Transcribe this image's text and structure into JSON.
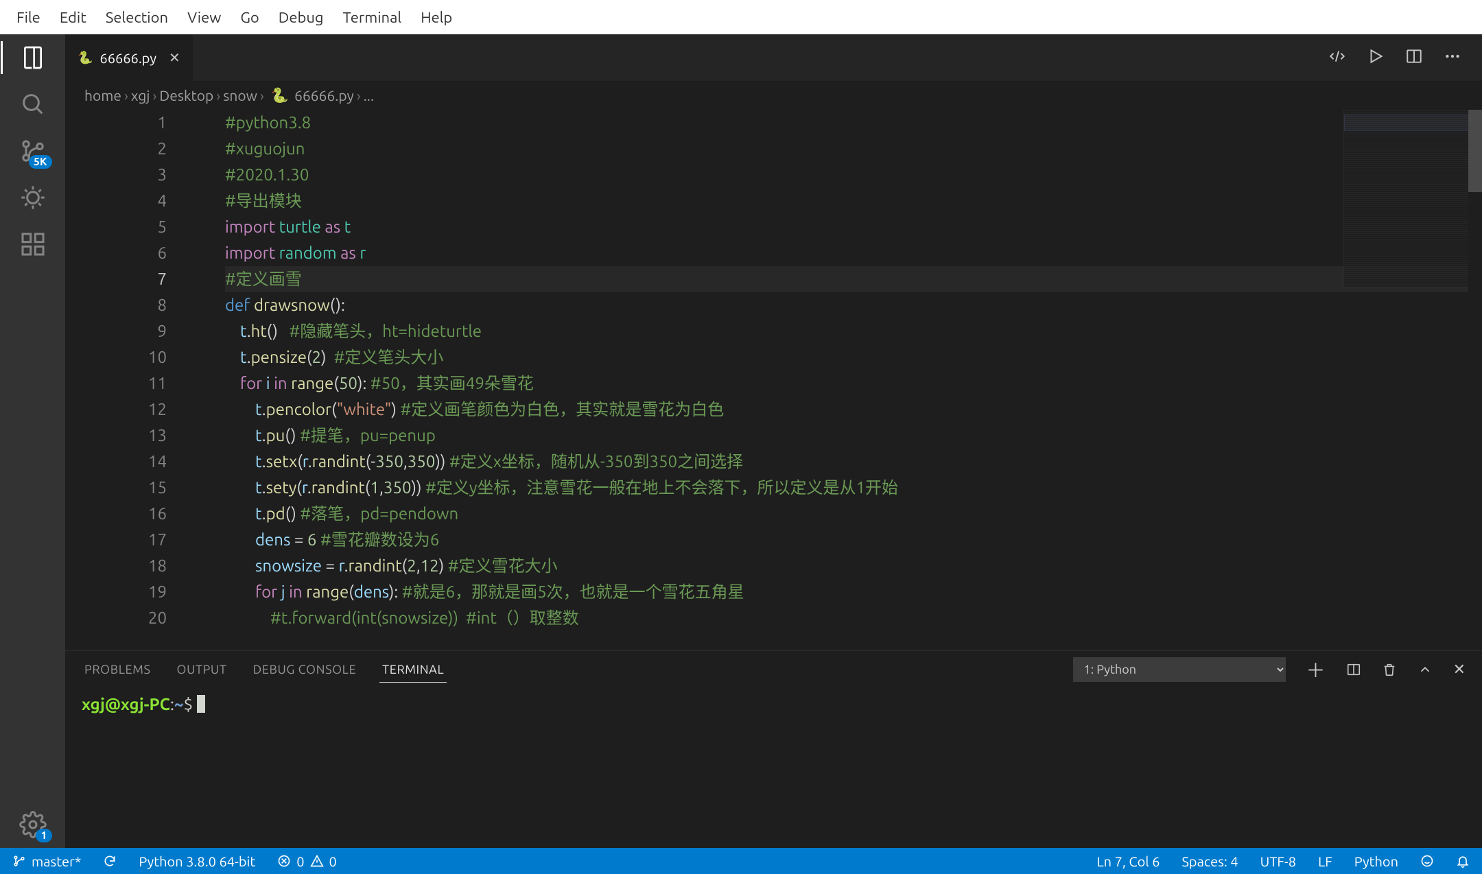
{
  "menu": [
    "File",
    "Edit",
    "Selection",
    "View",
    "Go",
    "Debug",
    "Terminal",
    "Help"
  ],
  "activity": {
    "scm_badge": "5K",
    "settings_badge": "1"
  },
  "tab": {
    "filename": "66666.py"
  },
  "breadcrumb": [
    "home",
    "xgj",
    "Desktop",
    "snow",
    "66666.py",
    "..."
  ],
  "code": {
    "lines": [
      {
        "n": "1",
        "seg": [
          [
            "c-cmt",
            "#python3.8"
          ]
        ]
      },
      {
        "n": "2",
        "seg": [
          [
            "c-cmt",
            "#xuguojun"
          ]
        ]
      },
      {
        "n": "3",
        "seg": [
          [
            "c-cmt",
            "#2020.1.30"
          ]
        ]
      },
      {
        "n": "4",
        "seg": [
          [
            "c-cmt",
            "#导出模块"
          ]
        ]
      },
      {
        "n": "5",
        "seg": [
          [
            "c-kw",
            "import"
          ],
          [
            "c-pn",
            " "
          ],
          [
            "c-mod",
            "turtle"
          ],
          [
            "c-pn",
            " "
          ],
          [
            "c-kw",
            "as"
          ],
          [
            "c-pn",
            " "
          ],
          [
            "c-mod",
            "t"
          ]
        ]
      },
      {
        "n": "6",
        "seg": [
          [
            "c-kw",
            "import"
          ],
          [
            "c-pn",
            " "
          ],
          [
            "c-mod",
            "random"
          ],
          [
            "c-pn",
            " "
          ],
          [
            "c-kw",
            "as"
          ],
          [
            "c-pn",
            " "
          ],
          [
            "c-mod",
            "r"
          ]
        ]
      },
      {
        "n": "7",
        "cur": true,
        "seg": [
          [
            "c-cmt",
            "#定义画雪"
          ]
        ]
      },
      {
        "n": "8",
        "seg": [
          [
            "c-def",
            "def"
          ],
          [
            "c-pn",
            " "
          ],
          [
            "c-fn",
            "drawsnow"
          ],
          [
            "c-pn",
            "():"
          ]
        ]
      },
      {
        "n": "9",
        "seg": [
          [
            "c-pn",
            "    "
          ],
          [
            "c-var",
            "t"
          ],
          [
            "c-pn",
            "."
          ],
          [
            "c-fn",
            "ht"
          ],
          [
            "c-pn",
            "()   "
          ],
          [
            "c-cmt",
            "#隐藏笔头，ht=hideturtle"
          ]
        ]
      },
      {
        "n": "10",
        "seg": [
          [
            "c-pn",
            "    "
          ],
          [
            "c-var",
            "t"
          ],
          [
            "c-pn",
            "."
          ],
          [
            "c-fn",
            "pensize"
          ],
          [
            "c-pn",
            "("
          ],
          [
            "c-num",
            "2"
          ],
          [
            "c-pn",
            ")  "
          ],
          [
            "c-cmt",
            "#定义笔头大小"
          ]
        ]
      },
      {
        "n": "11",
        "seg": [
          [
            "c-pn",
            "    "
          ],
          [
            "c-kw",
            "for"
          ],
          [
            "c-pn",
            " "
          ],
          [
            "c-var",
            "i"
          ],
          [
            "c-pn",
            " "
          ],
          [
            "c-kw",
            "in"
          ],
          [
            "c-pn",
            " "
          ],
          [
            "c-fn",
            "range"
          ],
          [
            "c-pn",
            "("
          ],
          [
            "c-num",
            "50"
          ],
          [
            "c-pn",
            "): "
          ],
          [
            "c-cmt",
            "#50，其实画49朵雪花"
          ]
        ]
      },
      {
        "n": "12",
        "seg": [
          [
            "c-pn",
            "        "
          ],
          [
            "c-var",
            "t"
          ],
          [
            "c-pn",
            "."
          ],
          [
            "c-fn",
            "pencolor"
          ],
          [
            "c-pn",
            "("
          ],
          [
            "c-str",
            "\"white\""
          ],
          [
            "c-pn",
            ") "
          ],
          [
            "c-cmt",
            "#定义画笔颜色为白色，其实就是雪花为白色"
          ]
        ]
      },
      {
        "n": "13",
        "seg": [
          [
            "c-pn",
            "        "
          ],
          [
            "c-var",
            "t"
          ],
          [
            "c-pn",
            "."
          ],
          [
            "c-fn",
            "pu"
          ],
          [
            "c-pn",
            "() "
          ],
          [
            "c-cmt",
            "#提笔，pu=penup"
          ]
        ]
      },
      {
        "n": "14",
        "seg": [
          [
            "c-pn",
            "        "
          ],
          [
            "c-var",
            "t"
          ],
          [
            "c-pn",
            "."
          ],
          [
            "c-fn",
            "setx"
          ],
          [
            "c-pn",
            "("
          ],
          [
            "c-var",
            "r"
          ],
          [
            "c-pn",
            "."
          ],
          [
            "c-fn",
            "randint"
          ],
          [
            "c-pn",
            "(-"
          ],
          [
            "c-num",
            "350"
          ],
          [
            "c-pn",
            ","
          ],
          [
            "c-num",
            "350"
          ],
          [
            "c-pn",
            ")) "
          ],
          [
            "c-cmt",
            "#定义x坐标，随机从-350到350之间选择"
          ]
        ]
      },
      {
        "n": "15",
        "seg": [
          [
            "c-pn",
            "        "
          ],
          [
            "c-var",
            "t"
          ],
          [
            "c-pn",
            "."
          ],
          [
            "c-fn",
            "sety"
          ],
          [
            "c-pn",
            "("
          ],
          [
            "c-var",
            "r"
          ],
          [
            "c-pn",
            "."
          ],
          [
            "c-fn",
            "randint"
          ],
          [
            "c-pn",
            "("
          ],
          [
            "c-num",
            "1"
          ],
          [
            "c-pn",
            ","
          ],
          [
            "c-num",
            "350"
          ],
          [
            "c-pn",
            ")) "
          ],
          [
            "c-cmt",
            "#定义y坐标，注意雪花一般在地上不会落下，所以定义是从1开始"
          ]
        ]
      },
      {
        "n": "16",
        "seg": [
          [
            "c-pn",
            "        "
          ],
          [
            "c-var",
            "t"
          ],
          [
            "c-pn",
            "."
          ],
          [
            "c-fn",
            "pd"
          ],
          [
            "c-pn",
            "() "
          ],
          [
            "c-cmt",
            "#落笔，pd=pendown"
          ]
        ]
      },
      {
        "n": "17",
        "seg": [
          [
            "c-pn",
            "        "
          ],
          [
            "c-var",
            "dens"
          ],
          [
            "c-pn",
            " = "
          ],
          [
            "c-num",
            "6"
          ],
          [
            "c-pn",
            " "
          ],
          [
            "c-cmt",
            "#雪花瓣数设为6"
          ]
        ]
      },
      {
        "n": "18",
        "seg": [
          [
            "c-pn",
            "        "
          ],
          [
            "c-var",
            "snowsize"
          ],
          [
            "c-pn",
            " = "
          ],
          [
            "c-var",
            "r"
          ],
          [
            "c-pn",
            "."
          ],
          [
            "c-fn",
            "randint"
          ],
          [
            "c-pn",
            "("
          ],
          [
            "c-num",
            "2"
          ],
          [
            "c-pn",
            ","
          ],
          [
            "c-num",
            "12"
          ],
          [
            "c-pn",
            ") "
          ],
          [
            "c-cmt",
            "#定义雪花大小"
          ]
        ]
      },
      {
        "n": "19",
        "seg": [
          [
            "c-pn",
            "        "
          ],
          [
            "c-kw",
            "for"
          ],
          [
            "c-pn",
            " "
          ],
          [
            "c-var",
            "j"
          ],
          [
            "c-pn",
            " "
          ],
          [
            "c-kw",
            "in"
          ],
          [
            "c-pn",
            " "
          ],
          [
            "c-fn",
            "range"
          ],
          [
            "c-pn",
            "("
          ],
          [
            "c-var",
            "dens"
          ],
          [
            "c-pn",
            "): "
          ],
          [
            "c-cmt",
            "#就是6，那就是画5次，也就是一个雪花五角星"
          ]
        ]
      },
      {
        "n": "20",
        "seg": [
          [
            "c-pn",
            "            "
          ],
          [
            "c-cmt",
            "#t.forward(int(snowsize))  #int（）取整数"
          ]
        ]
      }
    ]
  },
  "panel": {
    "tabs": [
      "PROBLEMS",
      "OUTPUT",
      "DEBUG CONSOLE",
      "TERMINAL"
    ],
    "active": 3,
    "term_select": "1: Python",
    "term_user": "xgj",
    "term_host": "xgj-PC",
    "term_path": "~",
    "term_prompt": "$"
  },
  "status": {
    "branch": "master*",
    "python": "Python 3.8.0 64-bit",
    "errors": "0",
    "warnings": "0",
    "lncol": "Ln 7, Col 6",
    "spaces": "Spaces: 4",
    "encoding": "UTF-8",
    "eol": "LF",
    "lang": "Python"
  }
}
